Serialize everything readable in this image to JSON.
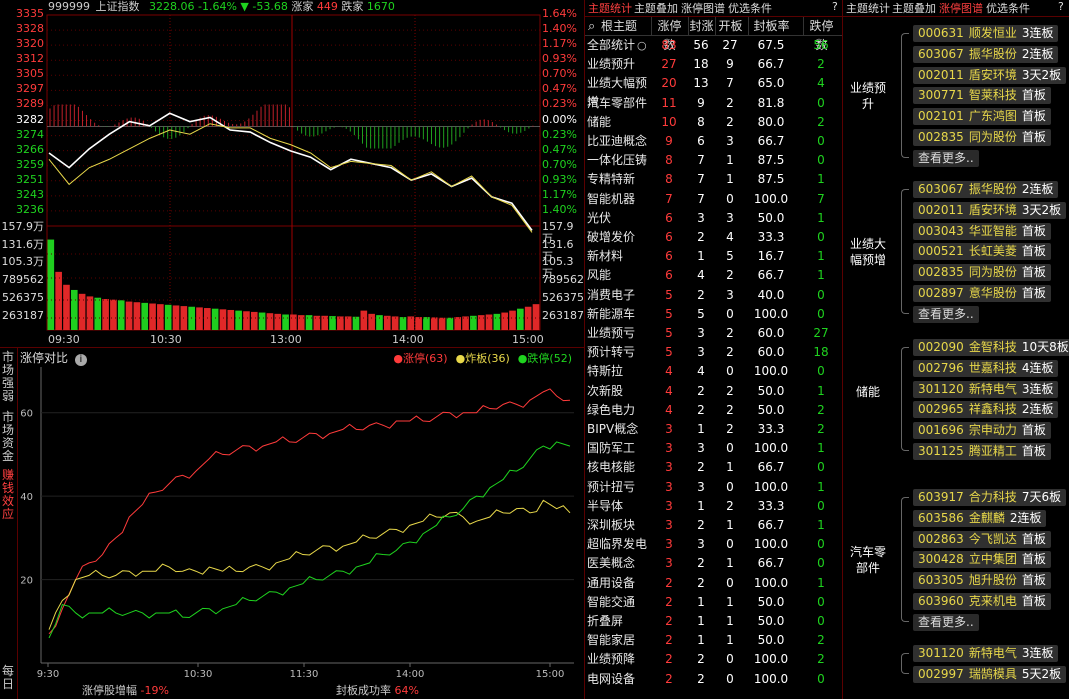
{
  "index_header": {
    "code": "999999",
    "name": "上证指数",
    "price": "3228.06",
    "pct": "-1.64%",
    "arrow": "▼",
    "chg": "-53.68",
    "up_label": "涨家",
    "up_count": "449",
    "down_label": "跌家",
    "down_count": "1670"
  },
  "price_axis_left": [
    "3335",
    "3328",
    "3320",
    "3312",
    "3305",
    "3297",
    "3289",
    "3282",
    "3274",
    "3266",
    "3259",
    "3251",
    "3243",
    "3236"
  ],
  "price_axis_right": [
    "1.64%",
    "1.40%",
    "1.17%",
    "0.93%",
    "0.70%",
    "0.47%",
    "0.23%",
    "0.00%",
    "0.23%",
    "0.47%",
    "0.70%",
    "0.93%",
    "1.17%",
    "1.40%"
  ],
  "volume_axis": [
    "157.9万",
    "131.6万",
    "105.3万",
    "789562",
    "526375",
    "263187"
  ],
  "volume_axis_right": [
    "157.9万",
    "131.6万",
    "105.3万",
    "789562",
    "526375",
    "263187"
  ],
  "time_axis": [
    "09:30",
    "10:30",
    "13:00",
    "14:00",
    "15:00"
  ],
  "bottom_panel": {
    "title": "涨停对比",
    "legend": [
      {
        "label": "涨停(63)",
        "color": "#ff3b3b"
      },
      {
        "label": "炸板(36)",
        "color": "#e8d84a"
      },
      {
        "label": "跌停(52)",
        "color": "#1fd31f"
      }
    ],
    "y_ticks": [
      "60",
      "40",
      "20"
    ],
    "x_ticks": [
      "9:30",
      "10:30",
      "11:30",
      "14:00",
      "15:00"
    ],
    "footer_left_label": "涨停股增幅",
    "footer_left_value": "-19%",
    "footer_right_label": "封板成功率",
    "footer_right_value": "64%"
  },
  "side_tabs": [
    "市场强弱",
    "市场资金",
    "赚钱效应",
    "每日"
  ],
  "themes_tabs": [
    "主题统计",
    "主题叠加",
    "涨停图谱",
    "优选条件",
    "?"
  ],
  "themes_columns": [
    "根主题",
    "涨停数",
    "封涨",
    "开板",
    "封板率",
    "跌停数"
  ],
  "themes_rows": [
    [
      "全部统计",
      "83",
      "56",
      "27",
      "67.5",
      "56"
    ],
    [
      "业绩预升",
      "27",
      "18",
      "9",
      "66.7",
      "2"
    ],
    [
      "业绩大幅预增",
      "20",
      "13",
      "7",
      "65.0",
      "4"
    ],
    [
      "汽车零部件",
      "11",
      "9",
      "2",
      "81.8",
      "0"
    ],
    [
      "储能",
      "10",
      "8",
      "2",
      "80.0",
      "2"
    ],
    [
      "比亚迪概念",
      "9",
      "6",
      "3",
      "66.7",
      "0"
    ],
    [
      "一体化压铸",
      "8",
      "7",
      "1",
      "87.5",
      "0"
    ],
    [
      "专精特新",
      "8",
      "7",
      "1",
      "87.5",
      "1"
    ],
    [
      "智能机器",
      "7",
      "7",
      "0",
      "100.0",
      "7"
    ],
    [
      "光伏",
      "6",
      "3",
      "3",
      "50.0",
      "1"
    ],
    [
      "破增发价",
      "6",
      "2",
      "4",
      "33.3",
      "0"
    ],
    [
      "新材料",
      "6",
      "1",
      "5",
      "16.7",
      "1"
    ],
    [
      "风能",
      "6",
      "4",
      "2",
      "66.7",
      "1"
    ],
    [
      "消费电子",
      "5",
      "2",
      "3",
      "40.0",
      "0"
    ],
    [
      "新能源车",
      "5",
      "5",
      "0",
      "100.0",
      "0"
    ],
    [
      "业绩预亏",
      "5",
      "3",
      "2",
      "60.0",
      "27"
    ],
    [
      "预计转亏",
      "5",
      "3",
      "2",
      "60.0",
      "18"
    ],
    [
      "特斯拉",
      "4",
      "4",
      "0",
      "100.0",
      "0"
    ],
    [
      "次新股",
      "4",
      "2",
      "2",
      "50.0",
      "1"
    ],
    [
      "绿色电力",
      "4",
      "2",
      "2",
      "50.0",
      "2"
    ],
    [
      "BIPV概念",
      "3",
      "1",
      "2",
      "33.3",
      "2"
    ],
    [
      "国防军工",
      "3",
      "3",
      "0",
      "100.0",
      "1"
    ],
    [
      "核电核能",
      "3",
      "2",
      "1",
      "66.7",
      "0"
    ],
    [
      "预计扭亏",
      "3",
      "3",
      "0",
      "100.0",
      "1"
    ],
    [
      "半导体",
      "3",
      "1",
      "2",
      "33.3",
      "0"
    ],
    [
      "深圳板块",
      "3",
      "2",
      "1",
      "66.7",
      "1"
    ],
    [
      "超临界发电",
      "3",
      "3",
      "0",
      "100.0",
      "0"
    ],
    [
      "医美概念",
      "3",
      "2",
      "1",
      "66.7",
      "0"
    ],
    [
      "通用设备",
      "2",
      "2",
      "0",
      "100.0",
      "1"
    ],
    [
      "智能交通",
      "2",
      "1",
      "1",
      "50.0",
      "0"
    ],
    [
      "折叠屏",
      "2",
      "1",
      "1",
      "50.0",
      "0"
    ],
    [
      "智能家居",
      "2",
      "1",
      "1",
      "50.0",
      "2"
    ],
    [
      "业绩预降",
      "2",
      "2",
      "0",
      "100.0",
      "2"
    ],
    [
      "电网设备",
      "2",
      "2",
      "0",
      "100.0",
      "0"
    ]
  ],
  "detail_tabs": [
    "主题统计",
    "主题叠加",
    "涨停图谱",
    "优选条件",
    "?"
  ],
  "detail_groups": [
    {
      "label": "业绩预升",
      "stocks": [
        [
          "000631",
          "顺发恒业",
          "3连板"
        ],
        [
          "603067",
          "振华股份",
          "2连板"
        ],
        [
          "002011",
          "盾安环境",
          "3天2板"
        ],
        [
          "300771",
          "智莱科技",
          "首板"
        ],
        [
          "002101",
          "广东鸿图",
          "首板"
        ],
        [
          "002835",
          "同为股份",
          "首板"
        ]
      ],
      "more": "查看更多.."
    },
    {
      "label": "业绩大幅预增",
      "stocks": [
        [
          "603067",
          "振华股份",
          "2连板"
        ],
        [
          "002011",
          "盾安环境",
          "3天2板"
        ],
        [
          "003043",
          "华亚智能",
          "首板"
        ],
        [
          "000521",
          "长虹美菱",
          "首板"
        ],
        [
          "002835",
          "同为股份",
          "首板"
        ],
        [
          "002897",
          "意华股份",
          "首板"
        ]
      ],
      "more": "查看更多.."
    },
    {
      "label": "储能",
      "stocks": [
        [
          "002090",
          "金智科技",
          "10天8板"
        ],
        [
          "002796",
          "世嘉科技",
          "4连板"
        ],
        [
          "301120",
          "新特电气",
          "3连板"
        ],
        [
          "002965",
          "祥鑫科技",
          "2连板"
        ],
        [
          "001696",
          "宗申动力",
          "首板"
        ],
        [
          "301125",
          "腾亚精工",
          "首板"
        ]
      ],
      "more": ""
    },
    {
      "label": "汽车零部件",
      "stocks": [
        [
          "603917",
          "合力科技",
          "7天6板"
        ],
        [
          "603586",
          "金麒麟",
          "2连板"
        ],
        [
          "002863",
          "今飞凯达",
          "首板"
        ],
        [
          "300428",
          "立中集团",
          "首板"
        ],
        [
          "603305",
          "旭升股份",
          "首板"
        ],
        [
          "603960",
          "克来机电",
          "首板"
        ]
      ],
      "more": "查看更多.."
    },
    {
      "label": "",
      "stocks": [
        [
          "301120",
          "新特电气",
          "3连板"
        ],
        [
          "002997",
          "瑞鹄模具",
          "5天2板"
        ]
      ],
      "more": ""
    }
  ],
  "chart_data": [
    {
      "type": "line",
      "title": "上证指数",
      "x_labels": [
        "09:30",
        "10:30",
        "13:00",
        "14:00",
        "15:00"
      ],
      "ylim": [
        3236,
        3335
      ],
      "series": [
        {
          "color": "#ffffff",
          "values": [
            3269,
            3262,
            3271,
            3278,
            3284,
            3282,
            3288,
            3284,
            3286,
            3280,
            3279,
            3274,
            3270,
            3267,
            3261,
            3266,
            3264,
            3262,
            3256,
            3259,
            3253,
            3257,
            3248,
            3245,
            3232
          ]
        },
        {
          "color": "#e8d84a",
          "values": [
            3266,
            3254,
            3262,
            3266,
            3271,
            3276,
            3280,
            3278,
            3283,
            3281,
            3281,
            3276,
            3273,
            3269,
            3262,
            3265,
            3264,
            3263,
            3256,
            3260,
            3253,
            3258,
            3248,
            3244,
            3231
          ]
        }
      ]
    },
    {
      "type": "bar",
      "title": "volume",
      "ylim": [
        0,
        1579000
      ],
      "values": [
        1400000,
        900000,
        700000,
        620000,
        560000,
        520000,
        500000,
        480000,
        470000,
        460000,
        440000,
        430000,
        420000,
        410000,
        400000,
        390000,
        380000,
        370000,
        360000,
        350000,
        340000,
        330000,
        320000,
        310000,
        300000,
        290000,
        280000,
        270000,
        260000,
        250000,
        240000,
        240000,
        230000,
        230000,
        220000,
        220000,
        215000,
        210000,
        210000,
        205000,
        300000,
        250000,
        230000,
        220000,
        210000,
        200000,
        210000,
        200000,
        200000,
        195000,
        190000,
        190000,
        200000,
        210000,
        220000,
        230000,
        240000,
        250000,
        270000,
        300000,
        330000,
        360000,
        400000
      ]
    },
    {
      "type": "line",
      "title": "涨停对比",
      "x_labels": [
        "9:30",
        "10:30",
        "11:30",
        "14:00",
        "15:00"
      ],
      "ylim": [
        0,
        70
      ],
      "series": [
        {
          "name": "涨停(63)",
          "color": "#ff3b3b",
          "values": [
            7,
            13,
            20,
            24,
            26,
            30,
            35,
            38,
            41,
            43,
            45,
            46,
            49,
            50,
            51,
            52,
            52,
            53,
            53,
            54,
            55,
            55,
            56,
            56,
            57,
            57,
            58,
            58,
            58,
            59,
            60,
            60,
            60,
            61,
            62,
            62,
            63,
            65,
            64,
            63
          ]
        },
        {
          "name": "炸板(36)",
          "color": "#e8d84a",
          "values": [
            8,
            15,
            20,
            21,
            21,
            21,
            22,
            22,
            22,
            23,
            22,
            22,
            23,
            22,
            22,
            23,
            23,
            24,
            25,
            26,
            27,
            28,
            28,
            29,
            30,
            31,
            32,
            33,
            34,
            35,
            36,
            35,
            34,
            35,
            36,
            37,
            36,
            39,
            37,
            36
          ]
        },
        {
          "name": "跌停(52)",
          "color": "#1fd31f",
          "values": [
            6,
            14,
            12,
            12,
            12,
            12,
            12,
            12,
            12,
            12,
            11,
            12,
            13,
            13,
            14,
            15,
            16,
            17,
            18,
            19,
            20,
            21,
            22,
            23,
            24,
            26,
            27,
            29,
            31,
            33,
            35,
            37,
            40,
            42,
            44,
            46,
            49,
            52,
            53,
            52
          ]
        }
      ]
    }
  ]
}
